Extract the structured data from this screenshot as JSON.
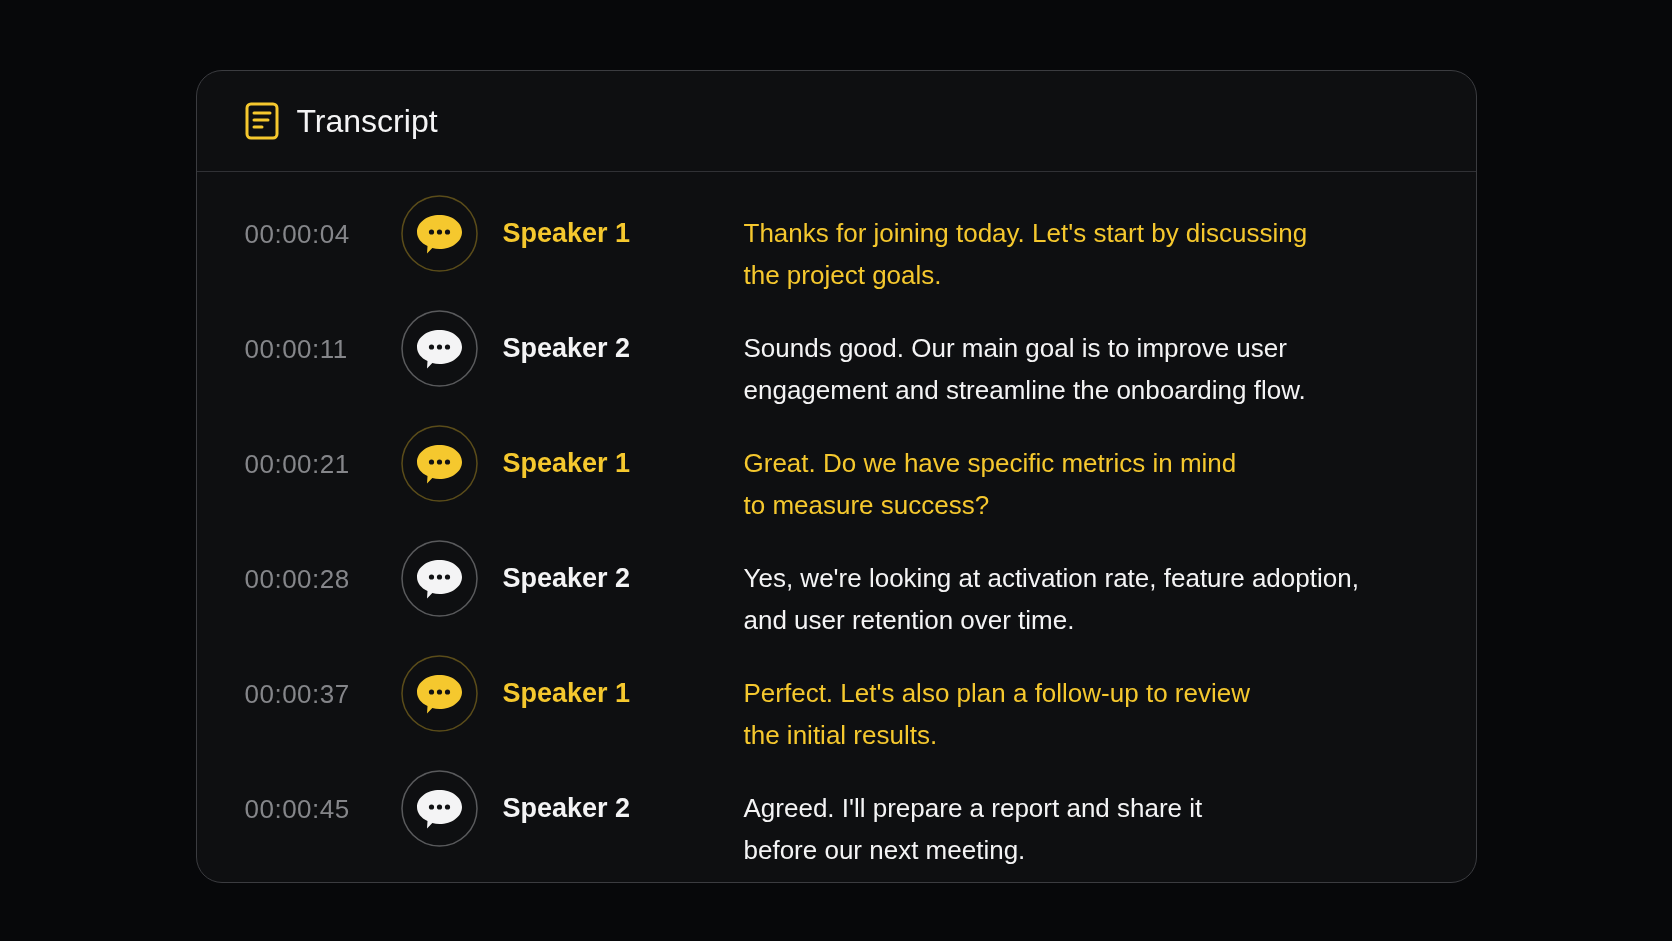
{
  "panel": {
    "title": "Transcript"
  },
  "entries": [
    {
      "time": "00:00:04",
      "speaker": "Speaker 1",
      "color": "#f5c82e",
      "lines": [
        "Thanks for joining today. Let's start by discussing",
        "the project goals."
      ]
    },
    {
      "time": "00:00:11",
      "speaker": "Speaker 2",
      "color": "#f4f4f5",
      "lines": [
        "Sounds good. Our main goal is to improve user",
        "engagement and streamline the onboarding flow."
      ]
    },
    {
      "time": "00:00:21",
      "speaker": "Speaker 1",
      "color": "#f5c82e",
      "lines": [
        "Great. Do we have specific metrics in mind",
        "to measure success?"
      ]
    },
    {
      "time": "00:00:28",
      "speaker": "Speaker 2",
      "color": "#f4f4f5",
      "lines": [
        "Yes, we're looking at activation rate, feature adoption,",
        "and user retention over time."
      ]
    },
    {
      "time": "00:00:37",
      "speaker": "Speaker 1",
      "color": "#f5c82e",
      "lines": [
        "Perfect. Let's also plan a follow-up to review",
        "the initial results."
      ]
    },
    {
      "time": "00:00:45",
      "speaker": "Speaker 2",
      "color": "#f4f4f5",
      "lines": [
        "Agreed. I'll prepare a report and share it",
        "before our next meeting."
      ]
    }
  ]
}
